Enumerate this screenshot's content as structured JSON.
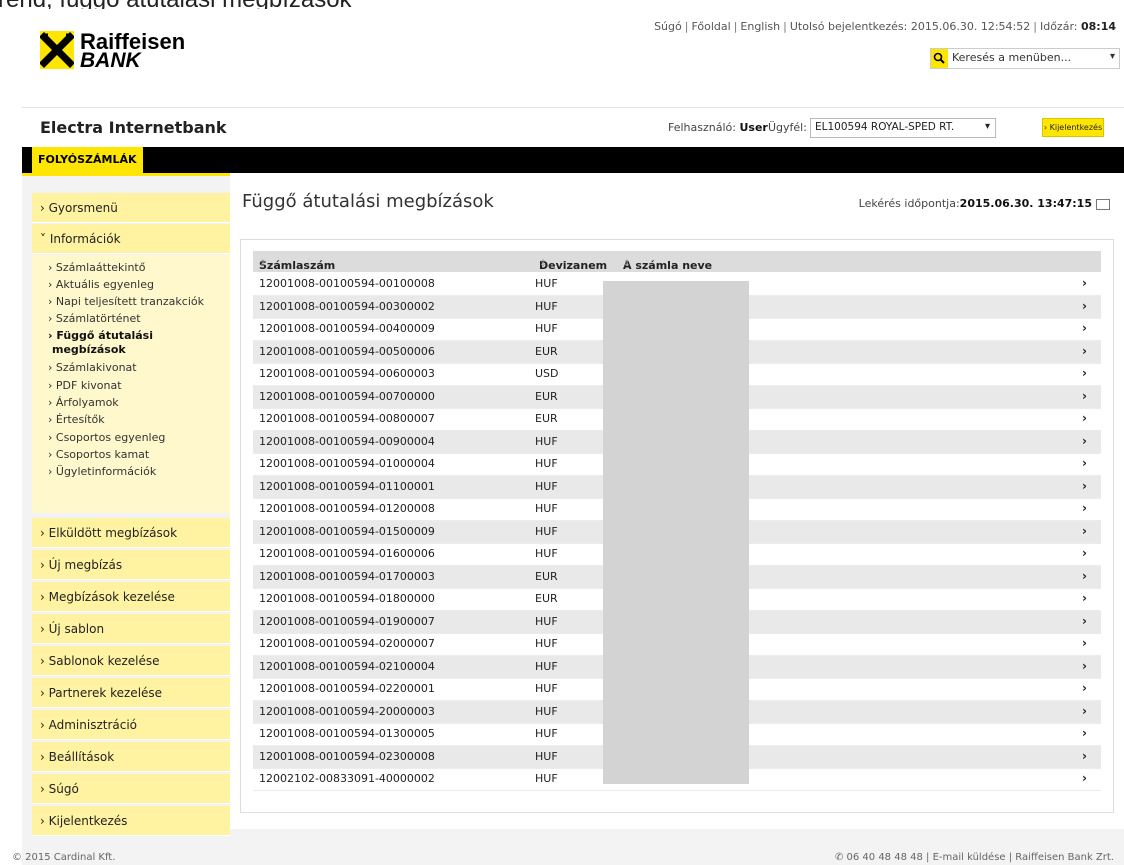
{
  "cut_text": "rend, függő átutalási megbízások",
  "logo": {
    "line1": "Raiffeisen",
    "line2": "BANK"
  },
  "top_links": {
    "help": "Súgó",
    "home": "Főoldal",
    "english": "English",
    "last_login": "Utolsó bejelentkezés: 2015.06.30. 12:54:52",
    "timer_label": "Időzár:",
    "timer_value": "08:14"
  },
  "search": {
    "placeholder": "Keresés a menüben..."
  },
  "app_title": "Electra Internetbank",
  "user": {
    "label": "Felhasználó:",
    "name": "User"
  },
  "client": {
    "label": "Ügyfél:",
    "value": "EL100594 ROYAL-SPED RT."
  },
  "logout_button": "› Kijelentkezés",
  "tab": "FOLYÓSZÁMLÁK",
  "sidebar": {
    "items": [
      "› Gyorsmenü",
      "˅ Információk",
      "› Elküldött megbízások",
      "› Új megbízás",
      "› Megbízások kezelése",
      "› Új sablon",
      "› Sablonok kezelése",
      "› Partnerek kezelése",
      "› Adminisztráció",
      "› Beállítások",
      "› Súgó",
      "› Kijelentkezés"
    ],
    "subitems": [
      "› Számlaáttekintő",
      "› Aktuális egyenleg",
      "› Napi teljesített tranzakciók",
      "› Számlatörténet",
      "› Függő átutalási",
      "megbízások",
      "› Számlakivonat",
      "› PDF kivonat",
      "› Árfolyamok",
      "› Értesítők",
      "› Csoportos egyenleg",
      "› Csoportos kamat",
      "› Ügyletinformációk"
    ]
  },
  "page_title": "Függő átutalási megbízások",
  "timestamp": {
    "label": "Lekérés időpontja:",
    "value": "2015.06.30. 13:47:15"
  },
  "table": {
    "headers": [
      "Számlaszám",
      "Devizanem",
      "A számla neve"
    ],
    "rows": [
      [
        "12001008-00100594-00100008",
        "HUF"
      ],
      [
        "12001008-00100594-00300002",
        "HUF"
      ],
      [
        "12001008-00100594-00400009",
        "HUF"
      ],
      [
        "12001008-00100594-00500006",
        "EUR"
      ],
      [
        "12001008-00100594-00600003",
        "USD"
      ],
      [
        "12001008-00100594-00700000",
        "EUR"
      ],
      [
        "12001008-00100594-00800007",
        "EUR"
      ],
      [
        "12001008-00100594-00900004",
        "HUF"
      ],
      [
        "12001008-00100594-01000004",
        "HUF"
      ],
      [
        "12001008-00100594-01100001",
        "HUF"
      ],
      [
        "12001008-00100594-01200008",
        "HUF"
      ],
      [
        "12001008-00100594-01500009",
        "HUF"
      ],
      [
        "12001008-00100594-01600006",
        "HUF"
      ],
      [
        "12001008-00100594-01700003",
        "EUR"
      ],
      [
        "12001008-00100594-01800000",
        "EUR"
      ],
      [
        "12001008-00100594-01900007",
        "HUF"
      ],
      [
        "12001008-00100594-02000007",
        "HUF"
      ],
      [
        "12001008-00100594-02100004",
        "HUF"
      ],
      [
        "12001008-00100594-02200001",
        "HUF"
      ],
      [
        "12001008-00100594-20000003",
        "HUF"
      ],
      [
        "12001008-00100594-01300005",
        "HUF"
      ],
      [
        "12001008-00100594-02300008",
        "HUF"
      ],
      [
        "12002102-00833091-40000002",
        "HUF"
      ]
    ]
  },
  "footer": {
    "left": "© 2015 Cardinal Kft.",
    "right": "✆ 06 40 48 48 48 | E-mail küldése | Raiffeisen Bank Zrt."
  }
}
